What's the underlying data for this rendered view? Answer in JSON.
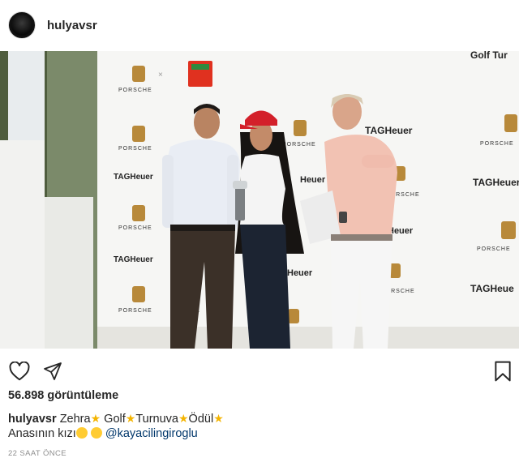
{
  "post": {
    "username": "hulyavsr",
    "views": "56.898 görüntüleme",
    "caption_username": "hulyavsr",
    "caption_words": [
      "Zehra",
      "Golf",
      "Turnuva",
      "Ödül"
    ],
    "caption_line2": "Anasının kızı",
    "mention": "@kayacilingiroglu",
    "timestamp": "22 SAAT ÖNCE"
  },
  "video": {
    "backdrop_brands": [
      "PORSCHE",
      "TAGHeuer",
      "TAG Heuer"
    ],
    "top_banner": "Golf Tur"
  },
  "icons": {
    "like": "heart-icon",
    "share": "paper-plane-icon",
    "save": "bookmark-icon"
  }
}
